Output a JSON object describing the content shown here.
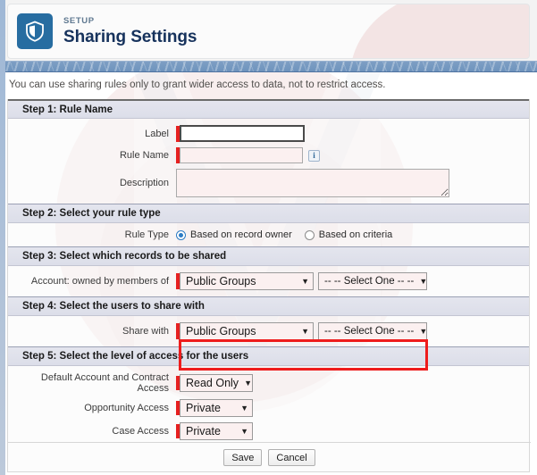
{
  "header": {
    "eyebrow": "SETUP",
    "title": "Sharing Settings",
    "icon": "shield-icon"
  },
  "notice": "You can use sharing rules only to grant wider access to data, not to restrict access.",
  "steps": [
    {
      "id": "step-1",
      "heading": "Step 1: Rule Name",
      "fields": [
        {
          "label": "Label",
          "type": "text",
          "value": "",
          "required": true,
          "focused": true
        },
        {
          "label": "Rule Name",
          "type": "text",
          "value": "",
          "required": true,
          "info_icon": "info-icon"
        },
        {
          "label": "Description",
          "type": "textarea",
          "value": "",
          "required": false
        }
      ]
    },
    {
      "id": "step-2",
      "heading": "Step 2: Select your rule type",
      "rule_type": {
        "label": "Rule Type",
        "options": [
          {
            "label": "Based on record owner",
            "selected": true
          },
          {
            "label": "Based on criteria",
            "selected": false
          }
        ]
      }
    },
    {
      "id": "step-3",
      "heading": "Step 3: Select which records to be shared",
      "owner_row": {
        "label": "Account: owned by members of",
        "group_select": "Public Groups",
        "value_select": "-- -- Select One -- --",
        "highlighted": true
      }
    },
    {
      "id": "step-4",
      "heading": "Step 4: Select the users to share with",
      "share_row": {
        "label": "Share with",
        "group_select": "Public Groups",
        "value_select": "-- -- Select One -- --"
      }
    },
    {
      "id": "step-5",
      "heading": "Step 5: Select the level of access for the users",
      "access_rows": [
        {
          "label": "Default Account and Contract Access",
          "value": "Read Only"
        },
        {
          "label": "Opportunity Access",
          "value": "Private"
        },
        {
          "label": "Case Access",
          "value": "Private"
        }
      ]
    }
  ],
  "footer": {
    "save_label": "Save",
    "cancel_label": "Cancel"
  },
  "colors": {
    "brand_blue": "#276da1",
    "title_navy": "#16325c",
    "required_red": "#e62020",
    "highlight_red": "#ee1c1c",
    "radio_blue": "#2b7bc4",
    "field_pink": "#fbf0f0"
  }
}
